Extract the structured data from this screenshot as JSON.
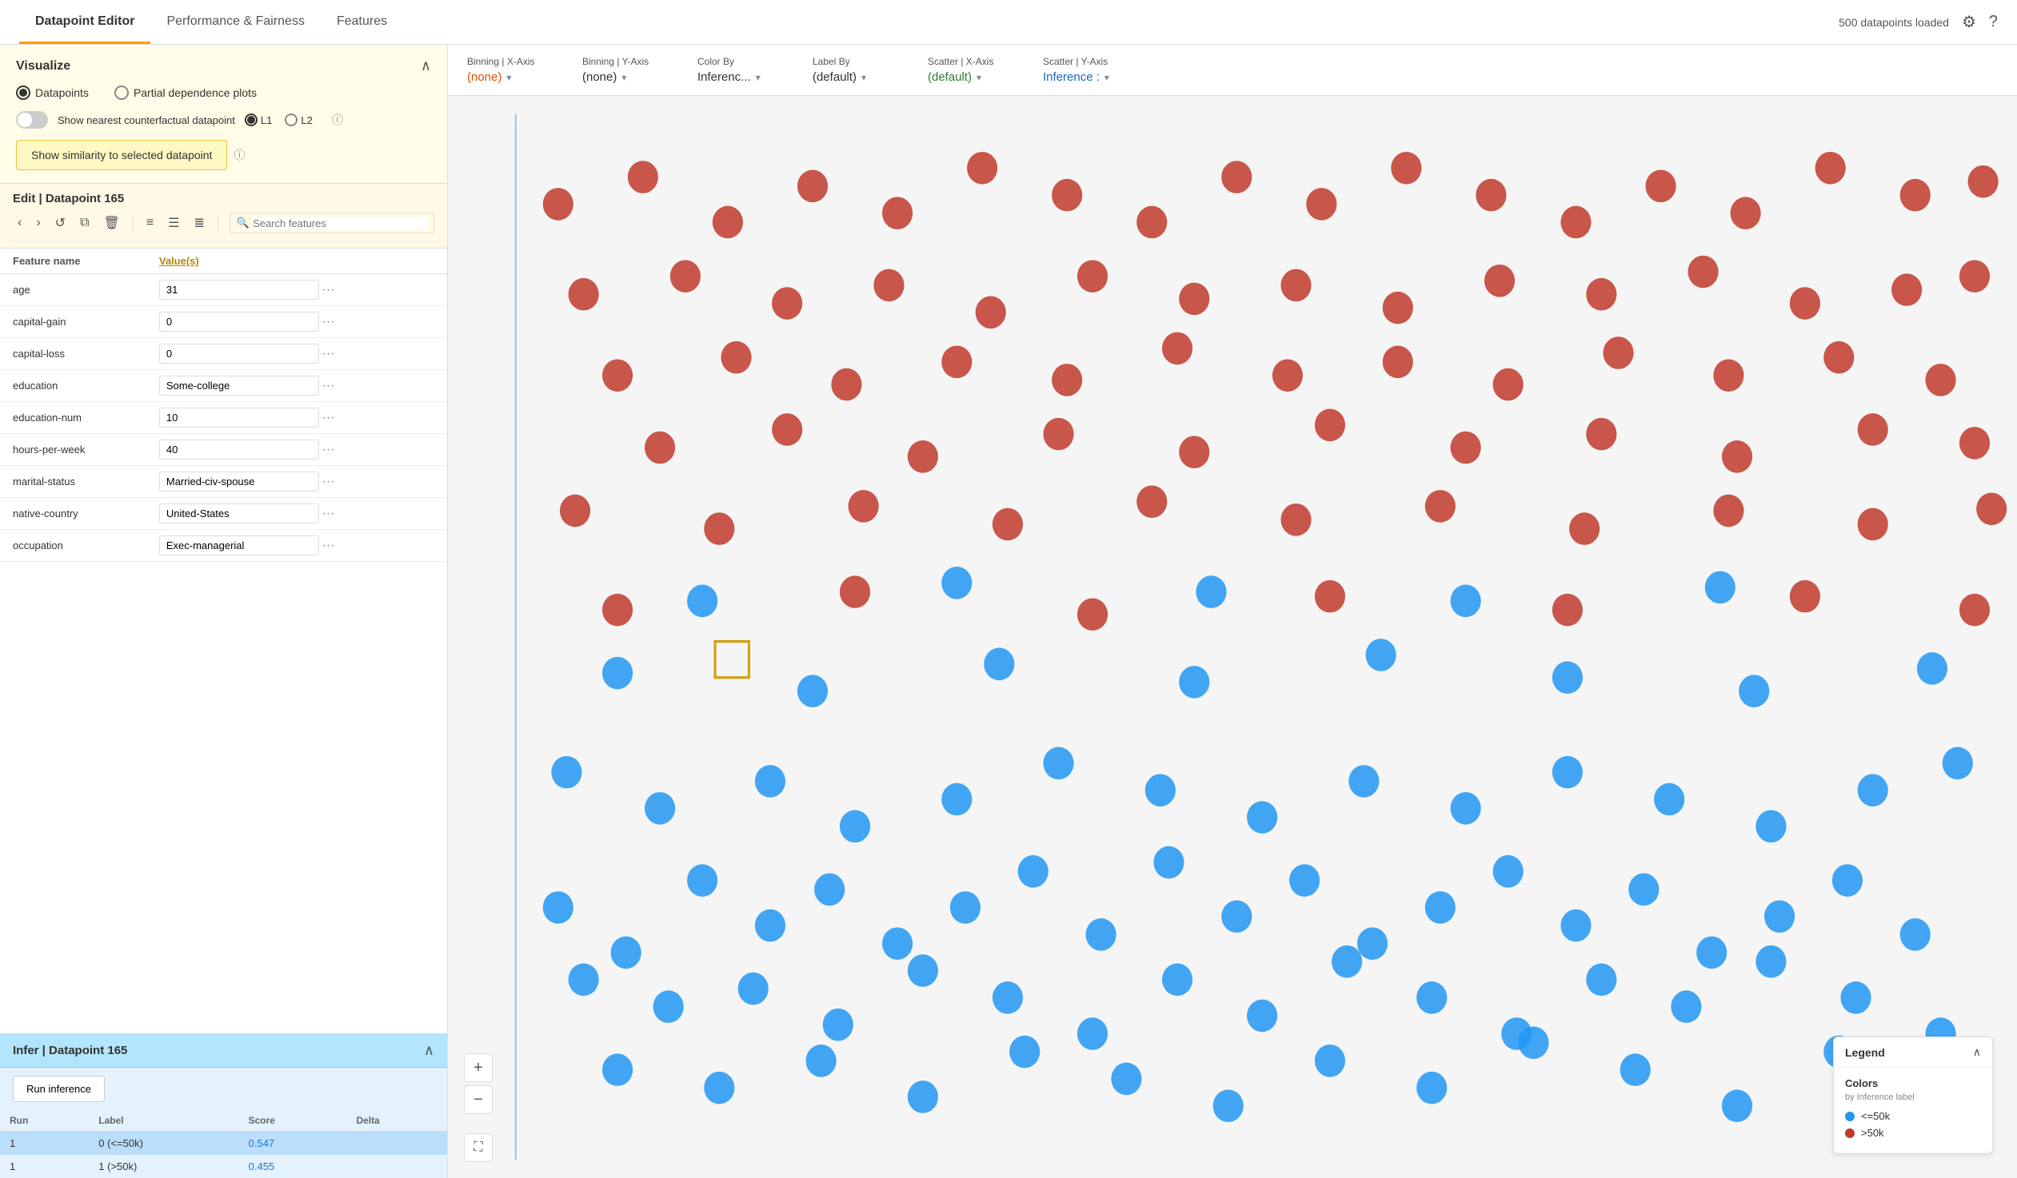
{
  "nav": {
    "tabs": [
      {
        "id": "datapoint-editor",
        "label": "Datapoint Editor",
        "active": true
      },
      {
        "id": "performance-fairness",
        "label": "Performance & Fairness",
        "active": false
      },
      {
        "id": "features",
        "label": "Features",
        "active": false
      }
    ],
    "datapoints_loaded": "500 datapoints loaded"
  },
  "left_panel": {
    "visualize": {
      "title": "Visualize",
      "radio_options": [
        {
          "id": "datapoints",
          "label": "Datapoints",
          "selected": true
        },
        {
          "id": "partial_dependence",
          "label": "Partial dependence plots",
          "selected": false
        }
      ],
      "toggle_label": "Show nearest counterfactual datapoint",
      "toggle_on": false,
      "l1_label": "L1",
      "l2_label": "L2",
      "l1_selected": true,
      "similarity_btn": "Show similarity to selected datapoint"
    },
    "edit": {
      "title": "Edit | Datapoint 165",
      "search_placeholder": "Search features",
      "columns": [
        {
          "id": "feature-name",
          "label": "Feature name"
        },
        {
          "id": "values",
          "label": "Value(s)"
        }
      ],
      "rows": [
        {
          "feature": "age",
          "value": "31"
        },
        {
          "feature": "capital-gain",
          "value": "0"
        },
        {
          "feature": "capital-loss",
          "value": "0"
        },
        {
          "feature": "education",
          "value": "Some-college"
        },
        {
          "feature": "education-num",
          "value": "10"
        },
        {
          "feature": "hours-per-week",
          "value": "40"
        },
        {
          "feature": "marital-status",
          "value": "Married-civ-spouse"
        },
        {
          "feature": "native-country",
          "value": "United-States"
        },
        {
          "feature": "occupation",
          "value": "Exec-managerial"
        }
      ]
    },
    "infer": {
      "title": "Infer | Datapoint 165",
      "run_btn": "Run inference",
      "columns": [
        "Run",
        "Label",
        "Score",
        "Delta"
      ],
      "rows": [
        {
          "run": "1",
          "label": "0 (<=50k)",
          "score": "0.547",
          "delta": "",
          "selected": true
        },
        {
          "run": "1",
          "label": "1 (>50k)",
          "score": "0.455",
          "delta": "",
          "selected": false
        }
      ]
    }
  },
  "controls": {
    "binning_x": {
      "label": "Binning | X-Axis",
      "value": "(none)",
      "color": "orange"
    },
    "binning_y": {
      "label": "Binning | Y-Axis",
      "value": "(none)",
      "color": "dark"
    },
    "color_by": {
      "label": "Color By",
      "value": "Inferenc...",
      "color": "dark"
    },
    "label_by": {
      "label": "Label By",
      "value": "(default)",
      "color": "dark"
    },
    "scatter_x": {
      "label": "Scatter | X-Axis",
      "value": "(default)",
      "color": "green"
    },
    "scatter_y": {
      "label": "Scatter | Y-Axis",
      "value": "Inference :",
      "color": "blue"
    }
  },
  "scatter": {
    "y_axis_top": "0.994",
    "y_axis_bottom": "0.000502",
    "zoom_plus": "+",
    "zoom_minus": "−",
    "selected_point_color": "#d4a017"
  },
  "legend": {
    "title": "Legend",
    "colors_title": "Colors",
    "colors_subtitle": "by Inference label",
    "items": [
      {
        "label": "<=50k",
        "color": "blue"
      },
      {
        "label": ">50k",
        "color": "red"
      }
    ]
  }
}
